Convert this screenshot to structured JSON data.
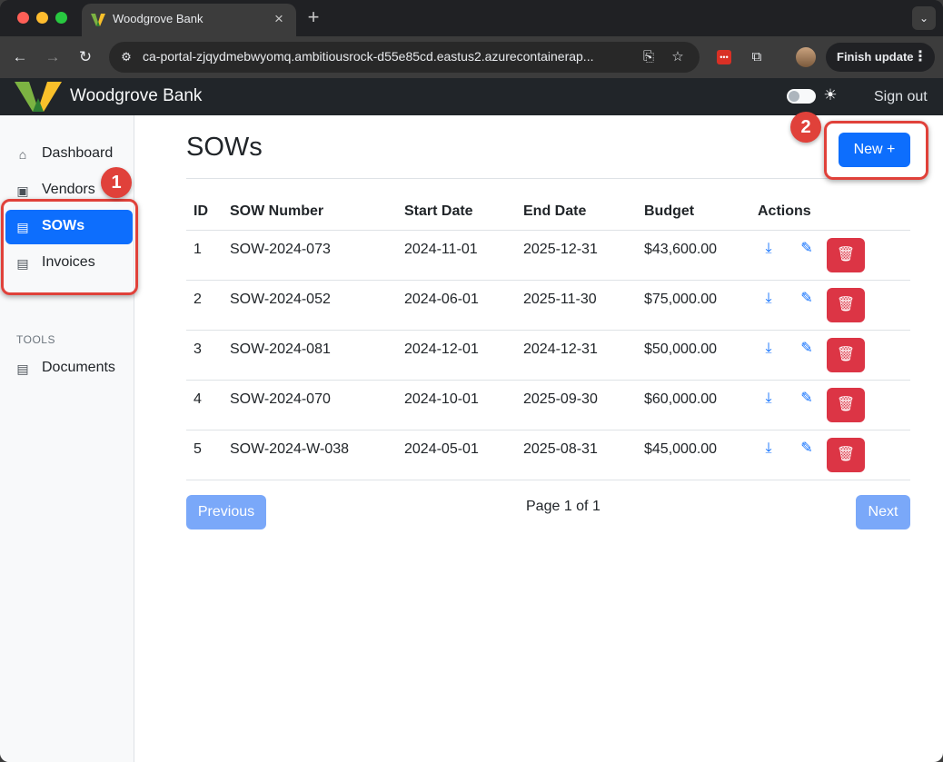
{
  "browser": {
    "tab_title": "Woodgrove Bank",
    "close_tab_glyph": "×",
    "new_tab_glyph": "+",
    "tab_menu_glyph": "⌄",
    "url": "ca-portal-zjqydmebwyomq.ambitiousrock-d55e85cd.eastus2.azurecontainerap...",
    "finish_update_label": "Finish update",
    "menu_glyph": "⋮"
  },
  "app": {
    "brand": "Woodgrove Bank",
    "sign_out": "Sign out",
    "brand_colors": {
      "green": "#7cb342",
      "yellow": "#f9c02a"
    }
  },
  "sidebar": {
    "items": [
      {
        "label": "Dashboard",
        "icon": "house-icon"
      },
      {
        "label": "Vendors",
        "icon": "briefcase-icon"
      },
      {
        "label": "SOWs",
        "icon": "file-contract-icon",
        "active": true
      },
      {
        "label": "Invoices",
        "icon": "file-text-icon"
      }
    ],
    "tools_heading": "TOOLS",
    "tools": [
      {
        "label": "Documents",
        "icon": "file-text-icon"
      }
    ]
  },
  "main": {
    "title": "SOWs",
    "new_button": "New +",
    "table": {
      "headers": [
        "ID",
        "SOW Number",
        "Start Date",
        "End Date",
        "Budget",
        "Actions"
      ],
      "rows": [
        [
          "1",
          "SOW-2024-073",
          "2024-11-01",
          "2025-12-31",
          "$43,600.00"
        ],
        [
          "2",
          "SOW-2024-052",
          "2024-06-01",
          "2025-11-30",
          "$75,000.00"
        ],
        [
          "3",
          "SOW-2024-081",
          "2024-12-01",
          "2024-12-31",
          "$50,000.00"
        ],
        [
          "4",
          "SOW-2024-070",
          "2024-10-01",
          "2025-09-30",
          "$60,000.00"
        ],
        [
          "5",
          "SOW-2024-W-038",
          "2024-05-01",
          "2025-08-31",
          "$45,000.00"
        ]
      ]
    },
    "pager": {
      "previous": "Previous",
      "info": "Page 1 of 1",
      "next": "Next"
    }
  },
  "annotations": {
    "step1": "1",
    "step2": "2",
    "color": "#e0413a"
  }
}
